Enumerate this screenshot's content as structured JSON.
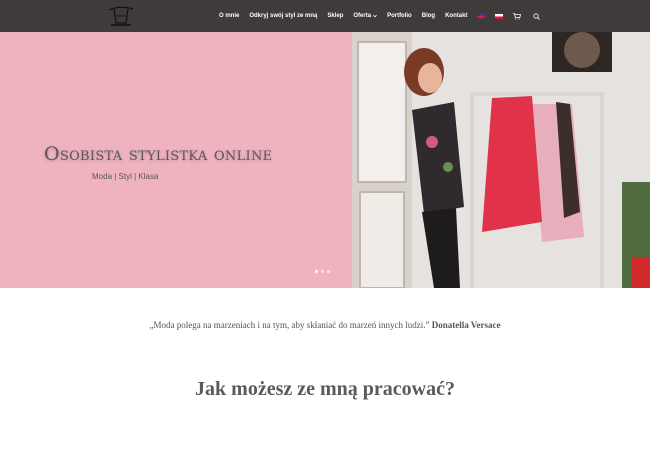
{
  "nav": {
    "items": [
      "O mnie",
      "Odkryj swój styl ze mną",
      "Sklep",
      "Oferta",
      "Portfolio",
      "Blog",
      "Kontakt"
    ],
    "dropdown_item_index": 3,
    "icons": [
      "flag-uk-icon",
      "flag-pl-icon",
      "cart-icon",
      "search-icon"
    ]
  },
  "hero": {
    "title": "Osobista stylistka online",
    "subtitle": "Moda | Styl | Klasa",
    "slides_count": 3,
    "active_slide": 1
  },
  "quote": {
    "text": "„Moda polega na marzeniach i na tym, aby skłaniać do marzeń innych ludzi.”",
    "author": "Donatella Versace"
  },
  "section": {
    "heading": "Jak możesz ze mną pracować?"
  },
  "colors": {
    "header_bg": "#3e3b3a",
    "hero_pink": "#efb3c0",
    "text_gray": "#5b5658"
  }
}
